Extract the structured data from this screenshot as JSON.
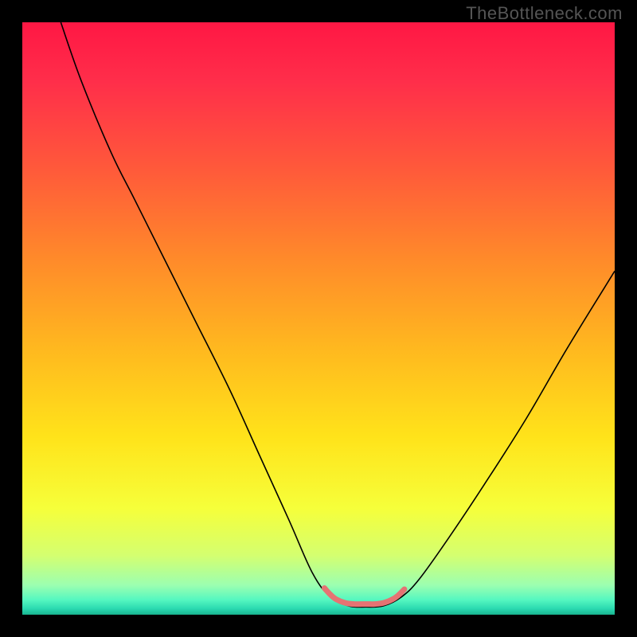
{
  "watermark": "TheBottleneck.com",
  "chart_data": {
    "type": "line",
    "title": "",
    "xlabel": "",
    "ylabel": "",
    "xlim": [
      0,
      100
    ],
    "ylim": [
      0,
      100
    ],
    "background_gradient": {
      "stops": [
        {
          "offset": 0.0,
          "color": "#ff1744"
        },
        {
          "offset": 0.1,
          "color": "#ff2e4a"
        },
        {
          "offset": 0.25,
          "color": "#ff5a3a"
        },
        {
          "offset": 0.4,
          "color": "#ff8a2a"
        },
        {
          "offset": 0.55,
          "color": "#ffb81f"
        },
        {
          "offset": 0.7,
          "color": "#ffe31a"
        },
        {
          "offset": 0.82,
          "color": "#f6ff3a"
        },
        {
          "offset": 0.9,
          "color": "#d4ff70"
        },
        {
          "offset": 0.95,
          "color": "#9cffb0"
        },
        {
          "offset": 0.975,
          "color": "#55f7c0"
        },
        {
          "offset": 0.99,
          "color": "#2ad9b0"
        },
        {
          "offset": 1.0,
          "color": "#19b590"
        }
      ]
    },
    "series": [
      {
        "name": "bottleneck-curve",
        "stroke": "#000000",
        "stroke_width": 1.6,
        "points": [
          {
            "x": 6.5,
            "y": 100
          },
          {
            "x": 10,
            "y": 90
          },
          {
            "x": 15,
            "y": 78
          },
          {
            "x": 19,
            "y": 70
          },
          {
            "x": 24,
            "y": 60
          },
          {
            "x": 29,
            "y": 50
          },
          {
            "x": 35,
            "y": 38
          },
          {
            "x": 40,
            "y": 27
          },
          {
            "x": 45,
            "y": 16
          },
          {
            "x": 49,
            "y": 7
          },
          {
            "x": 52,
            "y": 3
          },
          {
            "x": 55,
            "y": 1.5
          },
          {
            "x": 58,
            "y": 1.3
          },
          {
            "x": 61,
            "y": 1.5
          },
          {
            "x": 64,
            "y": 3
          },
          {
            "x": 67,
            "y": 6
          },
          {
            "x": 72,
            "y": 13
          },
          {
            "x": 78,
            "y": 22
          },
          {
            "x": 85,
            "y": 33
          },
          {
            "x": 92,
            "y": 45
          },
          {
            "x": 100,
            "y": 58
          }
        ]
      },
      {
        "name": "optimal-range-highlight",
        "stroke": "#e57373",
        "stroke_width": 7,
        "linecap": "round",
        "points": [
          {
            "x": 51.0,
            "y": 4.5
          },
          {
            "x": 52.0,
            "y": 3.4
          },
          {
            "x": 53.0,
            "y": 2.6
          },
          {
            "x": 54.5,
            "y": 2.0
          },
          {
            "x": 56.0,
            "y": 1.8
          },
          {
            "x": 58.0,
            "y": 1.8
          },
          {
            "x": 59.5,
            "y": 1.8
          },
          {
            "x": 61.0,
            "y": 2.0
          },
          {
            "x": 62.5,
            "y": 2.6
          },
          {
            "x": 63.5,
            "y": 3.3
          },
          {
            "x": 64.5,
            "y": 4.3
          }
        ]
      }
    ]
  }
}
